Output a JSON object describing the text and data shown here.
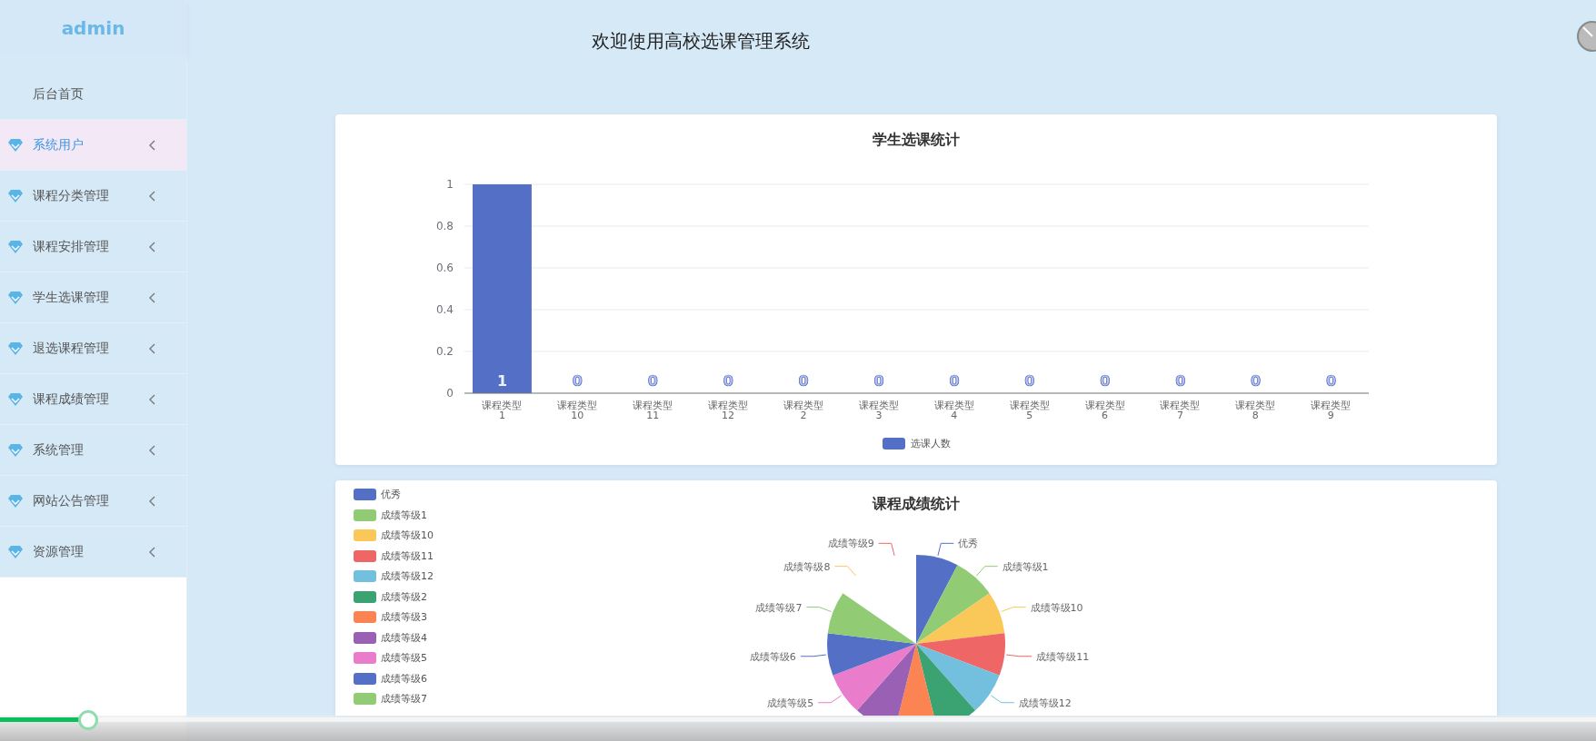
{
  "sidebar": {
    "logo": "admin",
    "items": [
      {
        "label": "后台首页",
        "kind": "link",
        "selected": false
      },
      {
        "label": "系统用户",
        "kind": "submenu",
        "selected": true
      },
      {
        "label": "课程分类管理",
        "kind": "submenu",
        "selected": false
      },
      {
        "label": "课程安排管理",
        "kind": "submenu",
        "selected": false
      },
      {
        "label": "学生选课管理",
        "kind": "submenu",
        "selected": false
      },
      {
        "label": "退选课程管理",
        "kind": "submenu",
        "selected": false
      },
      {
        "label": "课程成绩管理",
        "kind": "submenu",
        "selected": false
      },
      {
        "label": "系统管理",
        "kind": "submenu",
        "selected": false
      },
      {
        "label": "网站公告管理",
        "kind": "submenu",
        "selected": false
      },
      {
        "label": "资源管理",
        "kind": "submenu",
        "selected": false
      }
    ]
  },
  "header": {
    "title": "欢迎使用高校选课管理系统"
  },
  "enrollment_card": {
    "chart_data": {
      "type": "bar",
      "title": "学生选课统计",
      "categories": [
        "课程类型1",
        "课程类型10",
        "课程类型11",
        "课程类型12",
        "课程类型2",
        "课程类型3",
        "课程类型4",
        "课程类型5",
        "课程类型6",
        "课程类型7",
        "课程类型8",
        "课程类型9"
      ],
      "series": [
        {
          "name": "选课人数",
          "color": "#5470c6",
          "values": [
            1,
            0,
            0,
            0,
            0,
            0,
            0,
            0,
            0,
            0,
            0,
            0
          ]
        }
      ],
      "ylim": [
        0,
        1
      ],
      "yticks": [
        0,
        0.2,
        0.4,
        0.6,
        0.8,
        1
      ],
      "data_labels": true,
      "grid": true,
      "legend": true
    }
  },
  "grades_card": {
    "chart_data": {
      "type": "pie",
      "title": "课程成绩统计",
      "categories": [
        "优秀",
        "成绩等级1",
        "成绩等级10",
        "成绩等级11",
        "成绩等级12",
        "成绩等级2",
        "成绩等级3",
        "成绩等级4",
        "成绩等级5",
        "成绩等级6",
        "成绩等级7",
        "成绩等级8",
        "成绩等级9"
      ],
      "series": [
        {
          "values": [
            1,
            1,
            1,
            1,
            1,
            1,
            1,
            1,
            1,
            1,
            1,
            0,
            0
          ],
          "colors": [
            "#5470c6",
            "#91cc75",
            "#fac858",
            "#ee6666",
            "#73c0de",
            "#3ba272",
            "#fc8452",
            "#9a60b4",
            "#ea7ccc",
            "#5470c6",
            "#91cc75",
            "#fac858",
            "#ee6666"
          ]
        }
      ],
      "legend": true
    }
  },
  "video_player": {
    "progress": {
      "level": 0.055
    }
  }
}
